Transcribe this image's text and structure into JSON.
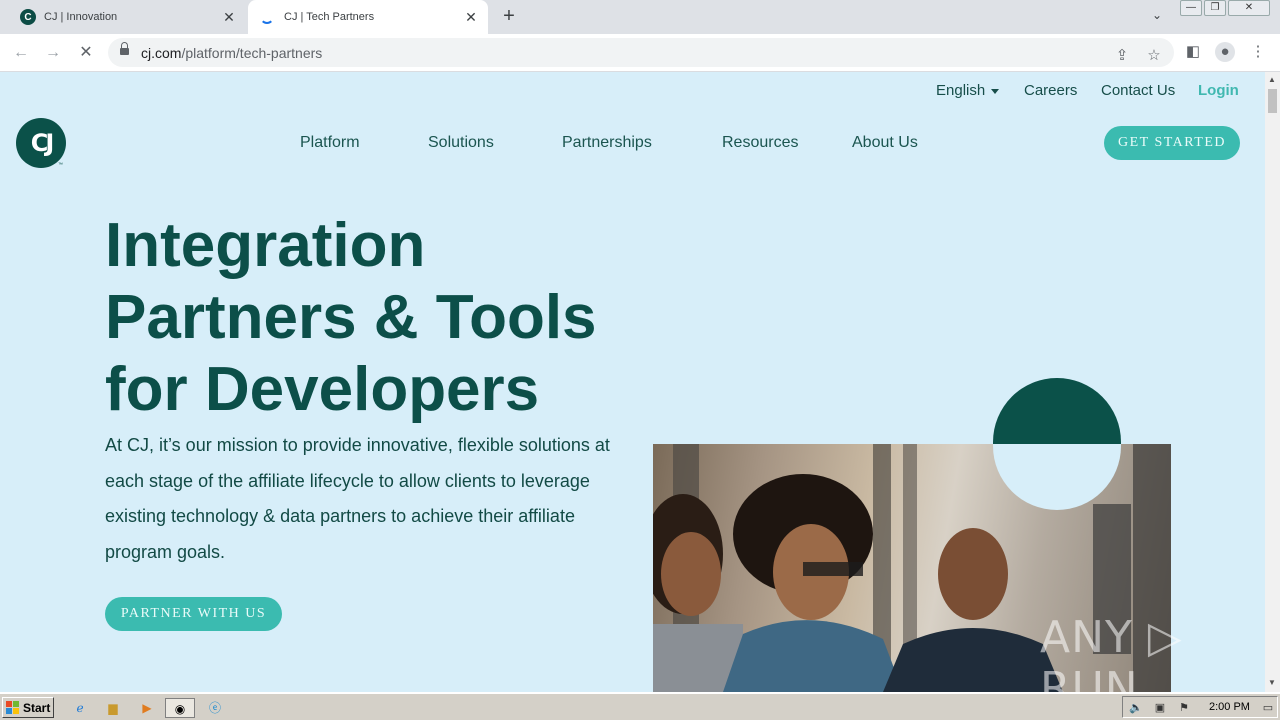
{
  "browser": {
    "tabs": [
      {
        "title": "CJ | Innovation",
        "active": false
      },
      {
        "title": "CJ | Tech Partners",
        "active": true
      }
    ],
    "url_domain": "cj.com",
    "url_path": "/platform/tech-partners"
  },
  "utility_nav": {
    "language": "English",
    "careers": "Careers",
    "contact": "Contact Us",
    "login": "Login"
  },
  "logo": {
    "text": "CJ",
    "tm": "™"
  },
  "main_nav": [
    "Platform",
    "Solutions",
    "Partnerships",
    "Resources",
    "About Us"
  ],
  "cta": {
    "get_started": "GET STARTED",
    "partner": "PARTNER WITH US"
  },
  "hero": {
    "title_lines": [
      "Integration",
      "Partners & Tools",
      "for Developers"
    ],
    "body": "At CJ, it’s our mission to provide innovative, flexible solutions at each stage of the affiliate lifecycle to allow clients to leverage existing technology & data partners to achieve their affiliate program goals."
  },
  "watermark": "ANY ▷ RUN",
  "taskbar": {
    "start": "Start",
    "clock": "2:00 PM"
  },
  "colors": {
    "page_bg": "#d7eef9",
    "brand_dark": "#0b5149",
    "brand_teal": "#3bbbb0"
  }
}
